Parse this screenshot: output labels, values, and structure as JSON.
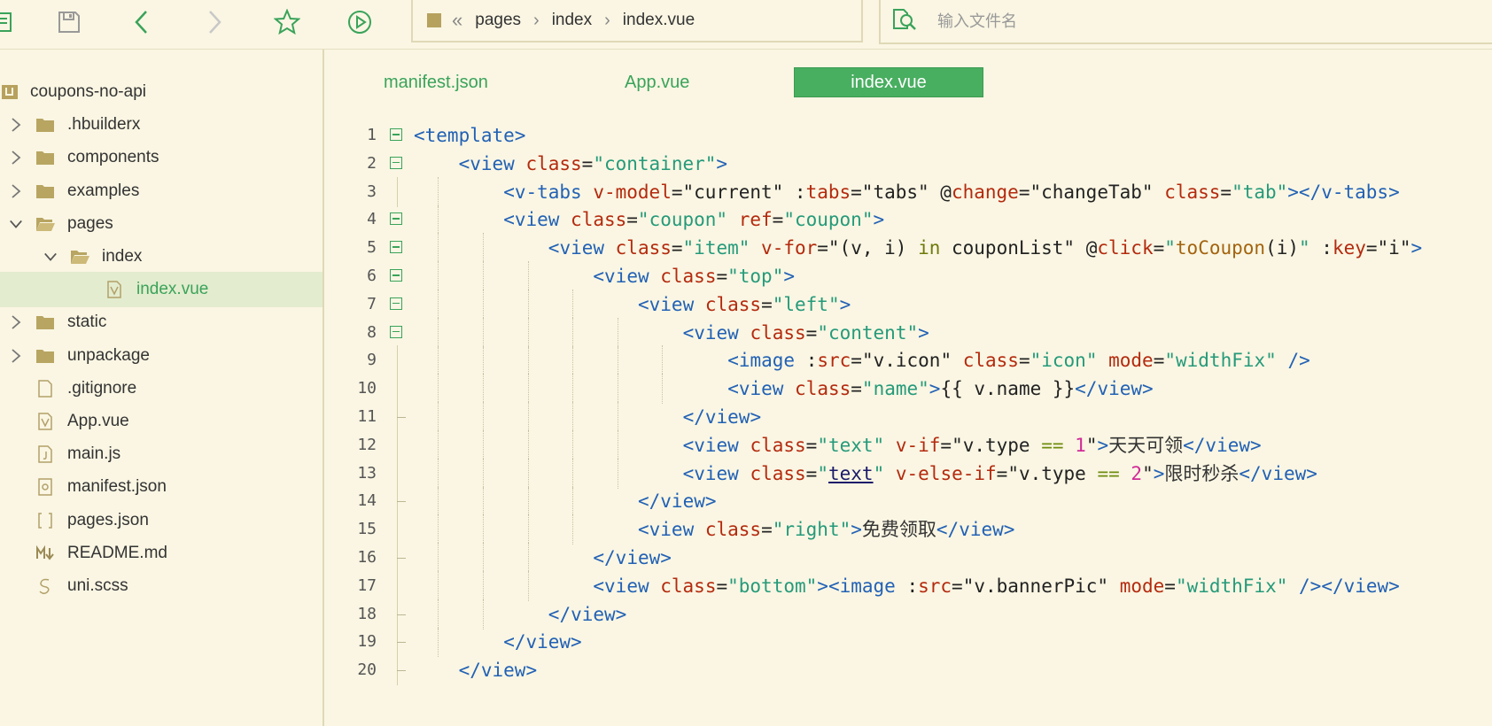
{
  "toolbar": {
    "icons": [
      "outline-icon",
      "save-icon",
      "back-icon",
      "forward-icon",
      "favorite-star-icon",
      "run-icon"
    ]
  },
  "breadcrumb": {
    "items": [
      "pages",
      "index",
      "index.vue"
    ]
  },
  "search": {
    "placeholder": "输入文件名"
  },
  "tree": {
    "items": [
      {
        "label": "coupons-no-api",
        "icon": "project-icon",
        "level": 0,
        "expand": "none",
        "selected": false
      },
      {
        "label": ".hbuilderx",
        "icon": "folder-icon",
        "level": 1,
        "expand": "collapsed",
        "selected": false
      },
      {
        "label": "components",
        "icon": "folder-icon",
        "level": 1,
        "expand": "collapsed",
        "selected": false
      },
      {
        "label": "examples",
        "icon": "folder-icon",
        "level": 1,
        "expand": "collapsed",
        "selected": false
      },
      {
        "label": "pages",
        "icon": "folder-open-icon",
        "level": 1,
        "expand": "expanded",
        "selected": false
      },
      {
        "label": "index",
        "icon": "folder-open-icon",
        "level": 2,
        "expand": "expanded",
        "selected": false
      },
      {
        "label": "index.vue",
        "icon": "vue-file-icon",
        "level": 3,
        "expand": "none",
        "selected": true
      },
      {
        "label": "static",
        "icon": "folder-icon",
        "level": 1,
        "expand": "collapsed",
        "selected": false
      },
      {
        "label": "unpackage",
        "icon": "folder-icon",
        "level": 1,
        "expand": "collapsed",
        "selected": false
      },
      {
        "label": ".gitignore",
        "icon": "file-icon",
        "level": 1,
        "expand": "none",
        "selected": false
      },
      {
        "label": "App.vue",
        "icon": "vue-file-icon",
        "level": 1,
        "expand": "none",
        "selected": false
      },
      {
        "label": "main.js",
        "icon": "js-file-icon",
        "level": 1,
        "expand": "none",
        "selected": false
      },
      {
        "label": "manifest.json",
        "icon": "manifest-file-icon",
        "level": 1,
        "expand": "none",
        "selected": false
      },
      {
        "label": "pages.json",
        "icon": "json-file-icon",
        "level": 1,
        "expand": "none",
        "selected": false
      },
      {
        "label": "README.md",
        "icon": "markdown-file-icon",
        "level": 1,
        "expand": "none",
        "selected": false
      },
      {
        "label": "uni.scss",
        "icon": "scss-file-icon",
        "level": 1,
        "expand": "none",
        "selected": false
      }
    ]
  },
  "tabs": [
    {
      "label": "manifest.json",
      "active": false
    },
    {
      "label": "App.vue",
      "active": false
    },
    {
      "label": "index.vue",
      "active": true
    }
  ],
  "code": {
    "lines": [
      {
        "n": "1",
        "indent": 0,
        "fold": "open",
        "tokens": [
          [
            "tag",
            "<template>"
          ]
        ]
      },
      {
        "n": "2",
        "indent": 1,
        "fold": "open",
        "tokens": [
          [
            "tag",
            "<view "
          ],
          [
            "attr",
            "class"
          ],
          [
            "pl",
            "="
          ],
          [
            "str",
            "\"container\""
          ],
          [
            "tag",
            ">"
          ]
        ]
      },
      {
        "n": "3",
        "indent": 2,
        "fold": "none",
        "tokens": [
          [
            "tag",
            "<v-tabs "
          ],
          [
            "attr",
            "v-model"
          ],
          [
            "pl",
            "=\"current\" :"
          ],
          [
            "attr",
            "tabs"
          ],
          [
            "pl",
            "=\"tabs\" @"
          ],
          [
            "attr",
            "change"
          ],
          [
            "pl",
            "=\"changeTab\" "
          ],
          [
            "attr",
            "class"
          ],
          [
            "pl",
            "="
          ],
          [
            "str",
            "\"tab\""
          ],
          [
            "tag",
            "></v-tabs>"
          ]
        ]
      },
      {
        "n": "4",
        "indent": 2,
        "fold": "open",
        "tokens": [
          [
            "tag",
            "<view "
          ],
          [
            "attr",
            "class"
          ],
          [
            "pl",
            "="
          ],
          [
            "str",
            "\"coupon\""
          ],
          [
            "pl",
            " "
          ],
          [
            "attr",
            "ref"
          ],
          [
            "pl",
            "="
          ],
          [
            "str",
            "\"coupon\""
          ],
          [
            "tag",
            ">"
          ]
        ]
      },
      {
        "n": "5",
        "indent": 3,
        "fold": "open",
        "tokens": [
          [
            "tag",
            "<view "
          ],
          [
            "attr",
            "class"
          ],
          [
            "pl",
            "="
          ],
          [
            "str",
            "\"item\""
          ],
          [
            "pl",
            " "
          ],
          [
            "attr",
            "v-for"
          ],
          [
            "pl",
            "=\"(v, i) "
          ],
          [
            "kw",
            "in"
          ],
          [
            "pl",
            " couponList\" @"
          ],
          [
            "attr",
            "click"
          ],
          [
            "pl",
            "="
          ],
          [
            "str",
            "\""
          ],
          [
            "fn",
            "toCoupon"
          ],
          [
            "pl",
            "(i)"
          ],
          [
            "str",
            "\""
          ],
          [
            "pl",
            " :"
          ],
          [
            "attr",
            "key"
          ],
          [
            "pl",
            "=\"i\""
          ],
          [
            "tag",
            ">"
          ]
        ]
      },
      {
        "n": "6",
        "indent": 4,
        "fold": "open",
        "tokens": [
          [
            "tag",
            "<view "
          ],
          [
            "attr",
            "class"
          ],
          [
            "pl",
            "="
          ],
          [
            "str",
            "\"top\""
          ],
          [
            "tag",
            ">"
          ]
        ]
      },
      {
        "n": "7",
        "indent": 5,
        "fold": "open",
        "tokens": [
          [
            "tag",
            "<view "
          ],
          [
            "attr",
            "class"
          ],
          [
            "pl",
            "="
          ],
          [
            "str",
            "\"left\""
          ],
          [
            "tag",
            ">"
          ]
        ]
      },
      {
        "n": "8",
        "indent": 6,
        "fold": "open",
        "tokens": [
          [
            "tag",
            "<view "
          ],
          [
            "attr",
            "class"
          ],
          [
            "pl",
            "="
          ],
          [
            "str",
            "\"content\""
          ],
          [
            "tag",
            ">"
          ]
        ]
      },
      {
        "n": "9",
        "indent": 7,
        "fold": "none",
        "tokens": [
          [
            "tag",
            "<image "
          ],
          [
            "pl",
            ":"
          ],
          [
            "attr",
            "src"
          ],
          [
            "pl",
            "=\"v.icon\" "
          ],
          [
            "attr",
            "class"
          ],
          [
            "pl",
            "="
          ],
          [
            "str",
            "\"icon\""
          ],
          [
            "pl",
            " "
          ],
          [
            "attr",
            "mode"
          ],
          [
            "pl",
            "="
          ],
          [
            "str",
            "\"widthFix\""
          ],
          [
            "pl",
            " "
          ],
          [
            "tag",
            "/>"
          ]
        ]
      },
      {
        "n": "10",
        "indent": 7,
        "fold": "none",
        "tokens": [
          [
            "tag",
            "<view "
          ],
          [
            "attr",
            "class"
          ],
          [
            "pl",
            "="
          ],
          [
            "str",
            "\"name\""
          ],
          [
            "tag",
            ">"
          ],
          [
            "pl",
            "{{ v.name }}"
          ],
          [
            "tag",
            "</view>"
          ]
        ]
      },
      {
        "n": "11",
        "indent": 6,
        "fold": "end",
        "tokens": [
          [
            "tag",
            "</view>"
          ]
        ]
      },
      {
        "n": "12",
        "indent": 6,
        "fold": "none",
        "tokens": [
          [
            "tag",
            "<view "
          ],
          [
            "attr",
            "class"
          ],
          [
            "pl",
            "="
          ],
          [
            "str",
            "\"text\""
          ],
          [
            "pl",
            " "
          ],
          [
            "attr",
            "v-if"
          ],
          [
            "pl",
            "=\"v.type "
          ],
          [
            "op",
            "=="
          ],
          [
            "pl",
            " "
          ],
          [
            "num",
            "1"
          ],
          [
            "pl",
            "\""
          ],
          [
            "tag",
            ">"
          ],
          [
            "cn",
            "天天可领"
          ],
          [
            "tag",
            "</view>"
          ]
        ]
      },
      {
        "n": "13",
        "indent": 6,
        "fold": "none",
        "tokens": [
          [
            "tag",
            "<view "
          ],
          [
            "attr",
            "class"
          ],
          [
            "pl",
            "="
          ],
          [
            "str",
            "\""
          ],
          [
            "u",
            "text"
          ],
          [
            "str",
            "\""
          ],
          [
            "pl",
            " "
          ],
          [
            "attr",
            "v-else-if"
          ],
          [
            "pl",
            "=\"v.type "
          ],
          [
            "op",
            "=="
          ],
          [
            "pl",
            " "
          ],
          [
            "num",
            "2"
          ],
          [
            "pl",
            "\""
          ],
          [
            "tag",
            ">"
          ],
          [
            "cn",
            "限时秒杀"
          ],
          [
            "tag",
            "</view>"
          ]
        ]
      },
      {
        "n": "14",
        "indent": 5,
        "fold": "end",
        "tokens": [
          [
            "tag",
            "</view>"
          ]
        ]
      },
      {
        "n": "15",
        "indent": 5,
        "fold": "none",
        "tokens": [
          [
            "tag",
            "<view "
          ],
          [
            "attr",
            "class"
          ],
          [
            "pl",
            "="
          ],
          [
            "str",
            "\"right\""
          ],
          [
            "tag",
            ">"
          ],
          [
            "cn",
            "免费领取"
          ],
          [
            "tag",
            "</view>"
          ]
        ]
      },
      {
        "n": "16",
        "indent": 4,
        "fold": "end",
        "tokens": [
          [
            "tag",
            "</view>"
          ]
        ]
      },
      {
        "n": "17",
        "indent": 4,
        "fold": "none",
        "tokens": [
          [
            "tag",
            "<view "
          ],
          [
            "attr",
            "class"
          ],
          [
            "pl",
            "="
          ],
          [
            "str",
            "\"bottom\""
          ],
          [
            "tag",
            ">"
          ],
          [
            "tag",
            "<image "
          ],
          [
            "pl",
            ":"
          ],
          [
            "attr",
            "src"
          ],
          [
            "pl",
            "=\"v.bannerPic\" "
          ],
          [
            "attr",
            "mode"
          ],
          [
            "pl",
            "="
          ],
          [
            "str",
            "\"widthFix\""
          ],
          [
            "pl",
            " "
          ],
          [
            "tag",
            "/></view>"
          ]
        ]
      },
      {
        "n": "18",
        "indent": 3,
        "fold": "end",
        "tokens": [
          [
            "tag",
            "</view>"
          ]
        ]
      },
      {
        "n": "19",
        "indent": 2,
        "fold": "end",
        "tokens": [
          [
            "tag",
            "</view>"
          ]
        ]
      },
      {
        "n": "20",
        "indent": 1,
        "fold": "end",
        "tokens": [
          [
            "tag",
            "</view>"
          ]
        ]
      }
    ]
  }
}
